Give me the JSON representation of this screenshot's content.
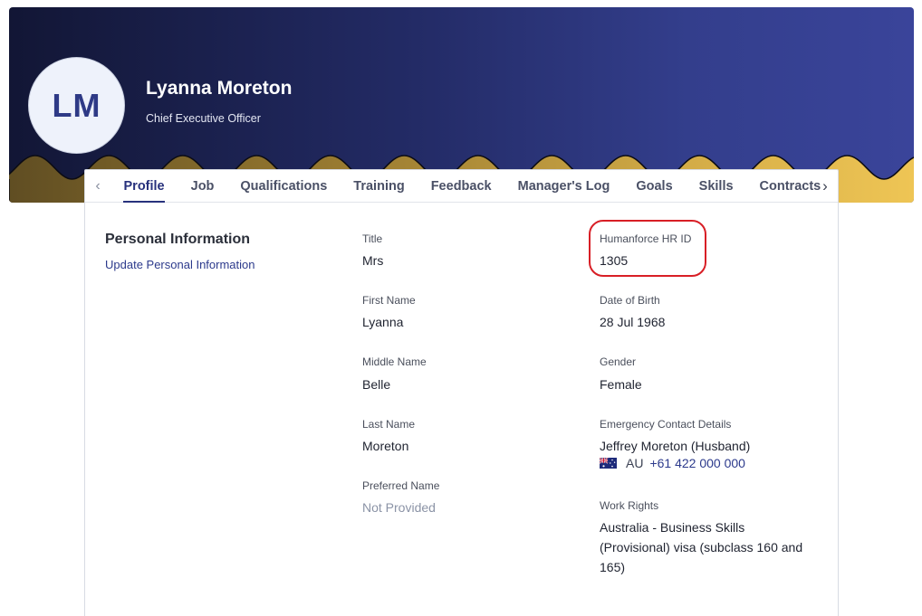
{
  "employee": {
    "initials": "LM",
    "name": "Lyanna Moreton",
    "role": "Chief Executive Officer"
  },
  "colors": {
    "header_dark": "#121635",
    "header_light": "#3a449a",
    "wave_gold": "#f7cc57",
    "accent": "#27317c",
    "highlight_red": "#d81f26"
  },
  "tabs": {
    "prev_icon": "chevron-left-icon",
    "next_icon": "chevron-right-icon",
    "items": [
      "Profile",
      "Job",
      "Qualifications",
      "Training",
      "Feedback",
      "Manager's Log",
      "Goals",
      "Skills",
      "Contracts"
    ],
    "active": "Profile"
  },
  "section": {
    "title": "Personal Information",
    "link": "Update Personal Information"
  },
  "fields": {
    "title": {
      "label": "Title",
      "value": "Mrs"
    },
    "first_name": {
      "label": "First Name",
      "value": "Lyanna"
    },
    "middle_name": {
      "label": "Middle Name",
      "value": "Belle"
    },
    "last_name": {
      "label": "Last Name",
      "value": "Moreton"
    },
    "preferred_name": {
      "label": "Preferred Name",
      "value": "Not Provided"
    },
    "hr_id": {
      "label": "Humanforce HR ID",
      "value": "1305"
    },
    "dob": {
      "label": "Date of Birth",
      "value": "28 Jul 1968"
    },
    "gender": {
      "label": "Gender",
      "value": "Female"
    },
    "emergency": {
      "label": "Emergency Contact Details",
      "value": "Jeffrey Moreton (Husband)",
      "flag_icon": "australia-flag-icon",
      "country": "AU",
      "phone": "+61 422 000 000"
    },
    "work_rights": {
      "label": "Work Rights",
      "line1": "Australia - Business Skills",
      "line2": "(Provisional) visa (subclass 160 and",
      "line3": "165)"
    }
  }
}
